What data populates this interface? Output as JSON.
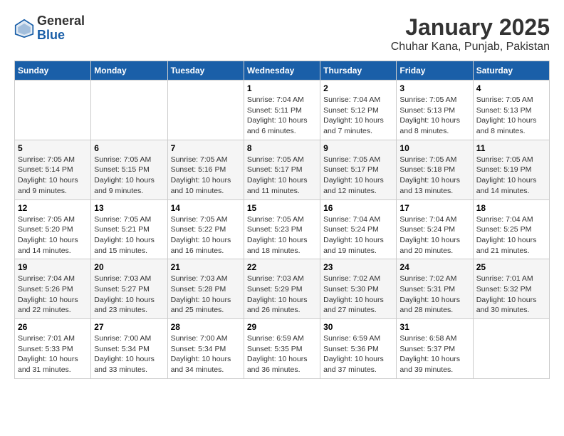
{
  "header": {
    "logo_general": "General",
    "logo_blue": "Blue",
    "title": "January 2025",
    "subtitle": "Chuhar Kana, Punjab, Pakistan"
  },
  "weekdays": [
    "Sunday",
    "Monday",
    "Tuesday",
    "Wednesday",
    "Thursday",
    "Friday",
    "Saturday"
  ],
  "weeks": [
    {
      "shaded": false,
      "days": [
        {
          "date": "",
          "info": ""
        },
        {
          "date": "",
          "info": ""
        },
        {
          "date": "",
          "info": ""
        },
        {
          "date": "1",
          "info": "Sunrise: 7:04 AM\nSunset: 5:11 PM\nDaylight: 10 hours\nand 6 minutes."
        },
        {
          "date": "2",
          "info": "Sunrise: 7:04 AM\nSunset: 5:12 PM\nDaylight: 10 hours\nand 7 minutes."
        },
        {
          "date": "3",
          "info": "Sunrise: 7:05 AM\nSunset: 5:13 PM\nDaylight: 10 hours\nand 8 minutes."
        },
        {
          "date": "4",
          "info": "Sunrise: 7:05 AM\nSunset: 5:13 PM\nDaylight: 10 hours\nand 8 minutes."
        }
      ]
    },
    {
      "shaded": true,
      "days": [
        {
          "date": "5",
          "info": "Sunrise: 7:05 AM\nSunset: 5:14 PM\nDaylight: 10 hours\nand 9 minutes."
        },
        {
          "date": "6",
          "info": "Sunrise: 7:05 AM\nSunset: 5:15 PM\nDaylight: 10 hours\nand 9 minutes."
        },
        {
          "date": "7",
          "info": "Sunrise: 7:05 AM\nSunset: 5:16 PM\nDaylight: 10 hours\nand 10 minutes."
        },
        {
          "date": "8",
          "info": "Sunrise: 7:05 AM\nSunset: 5:17 PM\nDaylight: 10 hours\nand 11 minutes."
        },
        {
          "date": "9",
          "info": "Sunrise: 7:05 AM\nSunset: 5:17 PM\nDaylight: 10 hours\nand 12 minutes."
        },
        {
          "date": "10",
          "info": "Sunrise: 7:05 AM\nSunset: 5:18 PM\nDaylight: 10 hours\nand 13 minutes."
        },
        {
          "date": "11",
          "info": "Sunrise: 7:05 AM\nSunset: 5:19 PM\nDaylight: 10 hours\nand 14 minutes."
        }
      ]
    },
    {
      "shaded": false,
      "days": [
        {
          "date": "12",
          "info": "Sunrise: 7:05 AM\nSunset: 5:20 PM\nDaylight: 10 hours\nand 14 minutes."
        },
        {
          "date": "13",
          "info": "Sunrise: 7:05 AM\nSunset: 5:21 PM\nDaylight: 10 hours\nand 15 minutes."
        },
        {
          "date": "14",
          "info": "Sunrise: 7:05 AM\nSunset: 5:22 PM\nDaylight: 10 hours\nand 16 minutes."
        },
        {
          "date": "15",
          "info": "Sunrise: 7:05 AM\nSunset: 5:23 PM\nDaylight: 10 hours\nand 18 minutes."
        },
        {
          "date": "16",
          "info": "Sunrise: 7:04 AM\nSunset: 5:24 PM\nDaylight: 10 hours\nand 19 minutes."
        },
        {
          "date": "17",
          "info": "Sunrise: 7:04 AM\nSunset: 5:24 PM\nDaylight: 10 hours\nand 20 minutes."
        },
        {
          "date": "18",
          "info": "Sunrise: 7:04 AM\nSunset: 5:25 PM\nDaylight: 10 hours\nand 21 minutes."
        }
      ]
    },
    {
      "shaded": true,
      "days": [
        {
          "date": "19",
          "info": "Sunrise: 7:04 AM\nSunset: 5:26 PM\nDaylight: 10 hours\nand 22 minutes."
        },
        {
          "date": "20",
          "info": "Sunrise: 7:03 AM\nSunset: 5:27 PM\nDaylight: 10 hours\nand 23 minutes."
        },
        {
          "date": "21",
          "info": "Sunrise: 7:03 AM\nSunset: 5:28 PM\nDaylight: 10 hours\nand 25 minutes."
        },
        {
          "date": "22",
          "info": "Sunrise: 7:03 AM\nSunset: 5:29 PM\nDaylight: 10 hours\nand 26 minutes."
        },
        {
          "date": "23",
          "info": "Sunrise: 7:02 AM\nSunset: 5:30 PM\nDaylight: 10 hours\nand 27 minutes."
        },
        {
          "date": "24",
          "info": "Sunrise: 7:02 AM\nSunset: 5:31 PM\nDaylight: 10 hours\nand 28 minutes."
        },
        {
          "date": "25",
          "info": "Sunrise: 7:01 AM\nSunset: 5:32 PM\nDaylight: 10 hours\nand 30 minutes."
        }
      ]
    },
    {
      "shaded": false,
      "days": [
        {
          "date": "26",
          "info": "Sunrise: 7:01 AM\nSunset: 5:33 PM\nDaylight: 10 hours\nand 31 minutes."
        },
        {
          "date": "27",
          "info": "Sunrise: 7:00 AM\nSunset: 5:34 PM\nDaylight: 10 hours\nand 33 minutes."
        },
        {
          "date": "28",
          "info": "Sunrise: 7:00 AM\nSunset: 5:34 PM\nDaylight: 10 hours\nand 34 minutes."
        },
        {
          "date": "29",
          "info": "Sunrise: 6:59 AM\nSunset: 5:35 PM\nDaylight: 10 hours\nand 36 minutes."
        },
        {
          "date": "30",
          "info": "Sunrise: 6:59 AM\nSunset: 5:36 PM\nDaylight: 10 hours\nand 37 minutes."
        },
        {
          "date": "31",
          "info": "Sunrise: 6:58 AM\nSunset: 5:37 PM\nDaylight: 10 hours\nand 39 minutes."
        },
        {
          "date": "",
          "info": ""
        }
      ]
    }
  ]
}
